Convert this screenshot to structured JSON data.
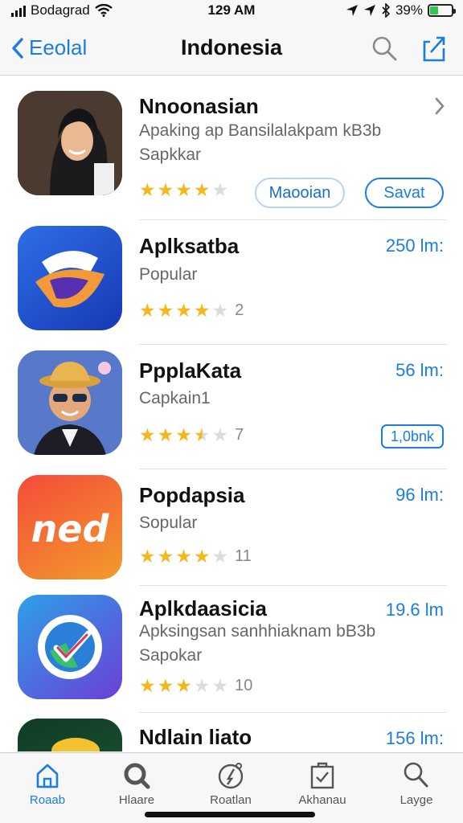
{
  "status_bar": {
    "carrier": "Bodagrad",
    "time": "129 AM",
    "battery_percent": "39%",
    "battery_level": 0.39,
    "icons": [
      "signal-icon",
      "wifi-icon",
      "location-icon",
      "bluetooth-icon",
      "battery-icon"
    ]
  },
  "nav": {
    "back_label": "Eeolal",
    "title": "Indonesia",
    "icons": [
      "back-chevron-icon",
      "search-icon",
      "share-icon"
    ]
  },
  "apps": [
    {
      "name": "Nnoonasian",
      "subtitle": "Apaking ap Bansilalakpam kB3b",
      "subtitle2": "Sapkkar",
      "rating": 4,
      "rating_count": "",
      "secondary_button": "Maooian",
      "primary_button": "Savat",
      "icon": "woman-hijab-photo"
    },
    {
      "name": "Aplksatba",
      "subtitle": "Popular",
      "rating": 4,
      "rating_count": "2",
      "size": "250 lm:",
      "icon": "blue-swoosh-logo"
    },
    {
      "name": "PpplaKata",
      "subtitle": "Capkain1",
      "rating": 3.5,
      "rating_count": "7",
      "size": "56 lm:",
      "button": "1,0bnk",
      "icon": "cartoon-man-hat"
    },
    {
      "name": "Popdapsia",
      "subtitle": "Sopular",
      "rating": 4,
      "rating_count": "11",
      "size": "96 lm:",
      "icon": "ned-logo",
      "icon_text": "ned"
    },
    {
      "name": "Aplkdaasicia",
      "subtitle": "Apksingsan sanhhiaknam bB3b",
      "subtitle2": "Sapokar",
      "rating": 3,
      "rating_count": "10",
      "size": "19.6 lm",
      "icon": "checkmark-badge-logo"
    },
    {
      "name": "Ndlain liato",
      "size": "156 lm:",
      "icon": "green-yellow-logo"
    }
  ],
  "tabs": [
    {
      "label": "Roaab",
      "icon": "home-icon",
      "active": true
    },
    {
      "label": "Hlaare",
      "icon": "search-bold-icon",
      "active": false
    },
    {
      "label": "Roatlan",
      "icon": "compass-icon",
      "active": false
    },
    {
      "label": "Akhanau",
      "icon": "clipboard-icon",
      "active": false
    },
    {
      "label": "Layge",
      "icon": "magnifier-icon",
      "active": false
    }
  ],
  "colors": {
    "accent": "#1a7de0",
    "star": "#f5b81c",
    "star_empty": "#dcdcdc",
    "battery": "#2fc74b"
  }
}
